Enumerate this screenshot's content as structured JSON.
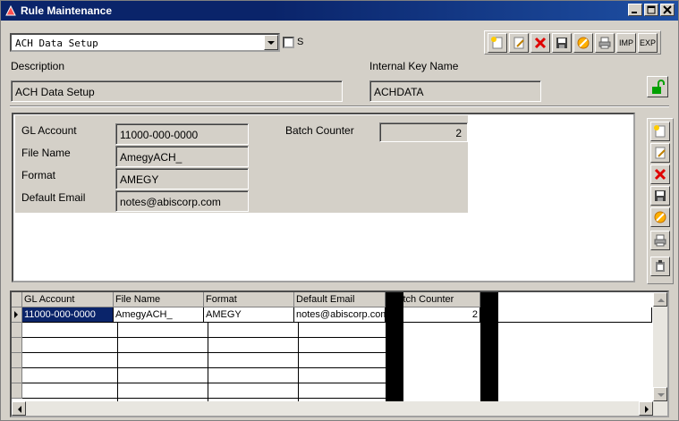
{
  "window": {
    "title": "Rule Maintenance"
  },
  "selector": {
    "value": "ACH Data Setup",
    "checkbox_label": "S"
  },
  "toolbar": {
    "imp_label": "IMP",
    "exp_label": "EXP"
  },
  "header": {
    "description_label": "Description",
    "description_value": "ACH Data Setup",
    "internal_key_label": "Internal Key Name",
    "internal_key_value": "ACHDATA"
  },
  "form": {
    "gl_account_label": "GL Account",
    "gl_account_value": "11000-000-0000",
    "file_name_label": "File Name",
    "file_name_value": "AmegyACH_",
    "format_label": "Format",
    "format_value": "AMEGY",
    "default_email_label": "Default Email",
    "default_email_value": "notes@abiscorp.com",
    "batch_counter_label": "Batch Counter",
    "batch_counter_value": "2"
  },
  "grid": {
    "columns": [
      "GL Account",
      "File Name",
      "Format",
      "Default Email",
      "Batch Counter"
    ],
    "rows": [
      [
        "11000-000-0000",
        "AmegyACH_",
        "AMEGY",
        "notes@abiscorp.com",
        "2"
      ]
    ]
  },
  "colors": {
    "title_bar": "#0a246a",
    "window_bg": "#d4d0c8",
    "selection": "#0a246a"
  },
  "icons": [
    "new-icon",
    "edit-icon",
    "delete-icon",
    "save-icon",
    "cancel-icon",
    "print-icon",
    "lock-open-icon",
    "clipboard-icon"
  ]
}
